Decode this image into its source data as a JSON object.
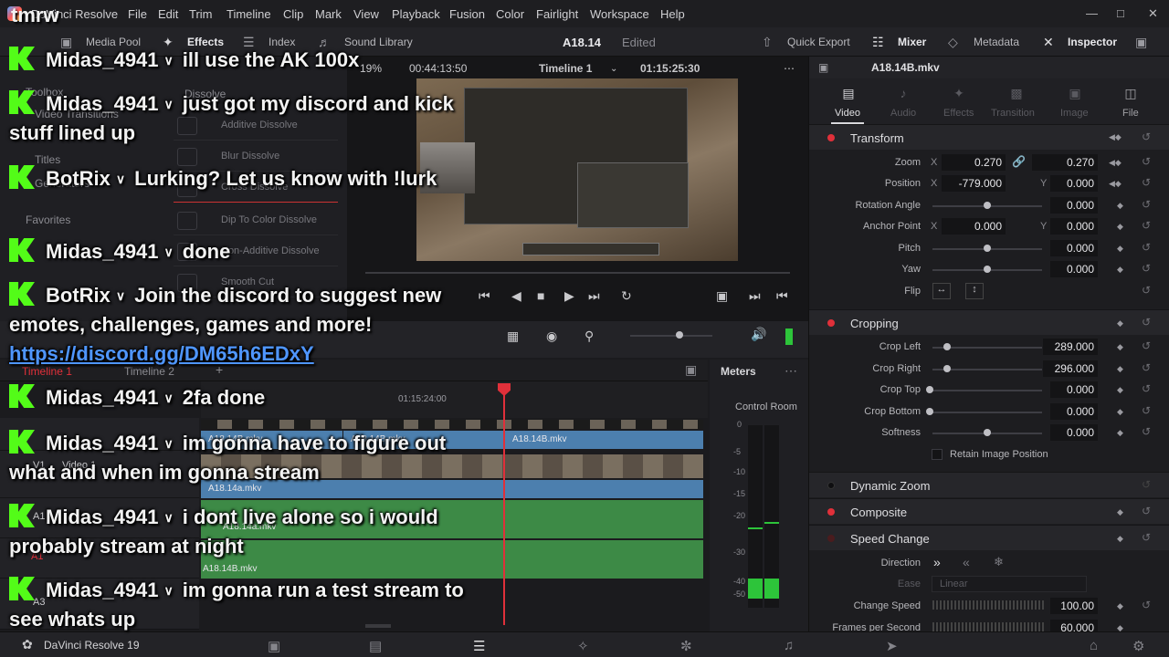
{
  "menubar": {
    "app_title": "DaVinci Resolve",
    "items": [
      "File",
      "Edit",
      "Trim",
      "Timeline",
      "Clip",
      "Mark",
      "View",
      "Playback",
      "Fusion",
      "Color",
      "Fairlight",
      "Workspace",
      "Help"
    ],
    "window_controls": [
      "minimize-icon",
      "maximize-icon",
      "close-icon"
    ]
  },
  "toolbar": {
    "media_pool": "Media Pool",
    "effects": "Effects",
    "index": "Index",
    "sound_library": "Sound Library",
    "project_name": "A18.14",
    "project_status": "Edited",
    "quick_export": "Quick Export",
    "mixer": "Mixer",
    "metadata": "Metadata",
    "inspector": "Inspector"
  },
  "effects_panel": {
    "toolbox": "Toolbox",
    "video_transitions": "Video Transitions",
    "titles": "Titles",
    "generators": "Generators",
    "favorites": "Favorites",
    "category": "Dissolve",
    "items": [
      "Additive Dissolve",
      "Blur Dissolve",
      "Cross Dissolve",
      "Dip To Color Dissolve",
      "Non-Additive Dissolve",
      "Smooth Cut"
    ]
  },
  "viewer": {
    "zoom": "19%",
    "duration": "00:44:13:50",
    "timeline_name": "Timeline 1",
    "timecode": "01:15:25:30"
  },
  "timeline": {
    "tabs": [
      "Timeline 1",
      "Timeline 2"
    ],
    "ruler_time": "01:15:24:00",
    "tracks": [
      {
        "id": "V1",
        "name": "Video 1"
      },
      {
        "id": "A1",
        "name": ""
      },
      {
        "id": "A1",
        "name": ""
      },
      {
        "id": "A3",
        "name": ""
      }
    ],
    "clips": {
      "v_top_left": "A18.14B.mkv",
      "v_top_mid": "A18.14B.mkv",
      "v_top_right": "A18.14B.mkv",
      "v1": "A18.14a.mkv",
      "a1": "A18.14a.mkv",
      "a2": "A18.14B.mkv"
    }
  },
  "meters": {
    "title": "Meters",
    "room": "Control Room",
    "scale": [
      "0",
      "-5",
      "-10",
      "-15",
      "-20",
      "-30",
      "-40",
      "-50"
    ]
  },
  "inspector": {
    "clip_name": "A18.14B.mkv",
    "tabs": [
      "Video",
      "Audio",
      "Effects",
      "Transition",
      "Image",
      "File"
    ],
    "transform": {
      "title": "Transform",
      "zoom_label": "Zoom",
      "zoom_x": "0.270",
      "zoom_y": "0.270",
      "position_label": "Position",
      "position_x": "-779.000",
      "position_y": "0.000",
      "rotation_label": "Rotation Angle",
      "rotation": "0.000",
      "anchor_label": "Anchor Point",
      "anchor_x": "0.000",
      "anchor_y": "0.000",
      "pitch_label": "Pitch",
      "pitch": "0.000",
      "yaw_label": "Yaw",
      "yaw": "0.000",
      "flip_label": "Flip"
    },
    "cropping": {
      "title": "Cropping",
      "left_label": "Crop Left",
      "left": "289.000",
      "right_label": "Crop Right",
      "right": "296.000",
      "top_label": "Crop Top",
      "top": "0.000",
      "bottom_label": "Crop Bottom",
      "bottom": "0.000",
      "softness_label": "Softness",
      "softness": "0.000",
      "retain_label": "Retain Image Position"
    },
    "dynamic_zoom": "Dynamic Zoom",
    "composite": "Composite",
    "speed_change": {
      "title": "Speed Change",
      "direction_label": "Direction",
      "ease_label": "Ease",
      "ease_value": "Linear",
      "speed_label": "Change Speed",
      "speed": "100.00",
      "fps_label": "Frames per Second",
      "fps": "60.000"
    },
    "colors": {
      "red_dot": "#e0303a",
      "grey_dot": "#1a1a1c"
    }
  },
  "pagebar": {
    "brand": "DaVinci Resolve 19"
  },
  "chat": {
    "title": "tmrw",
    "messages": [
      {
        "user": "Midas_4941",
        "text": "ill use the AK 100x"
      },
      {
        "user": "Midas_4941",
        "text": "just got my discord and kick stuff lined up"
      },
      {
        "user": "BotRix",
        "text": "Lurking? Let us know with !lurk"
      },
      {
        "user": "Midas_4941",
        "text": "done"
      },
      {
        "user": "BotRix",
        "text": "Join the discord to suggest new emotes, challenges, games and more!",
        "link": "https://discord.gg/DM65h6EDxY"
      },
      {
        "user": "Midas_4941",
        "text": "2fa done"
      },
      {
        "user": "Midas_4941",
        "text": "im gonna have to figure out what and when im gonna stream"
      },
      {
        "user": "Midas_4941",
        "text": "i dont live alone so i would probably stream at night"
      },
      {
        "user": "Midas_4941",
        "text": "im gonna run a test stream to see whats up"
      }
    ],
    "colors": {
      "kick_green": "#53fc18",
      "link_blue": "#4f96ff"
    }
  }
}
